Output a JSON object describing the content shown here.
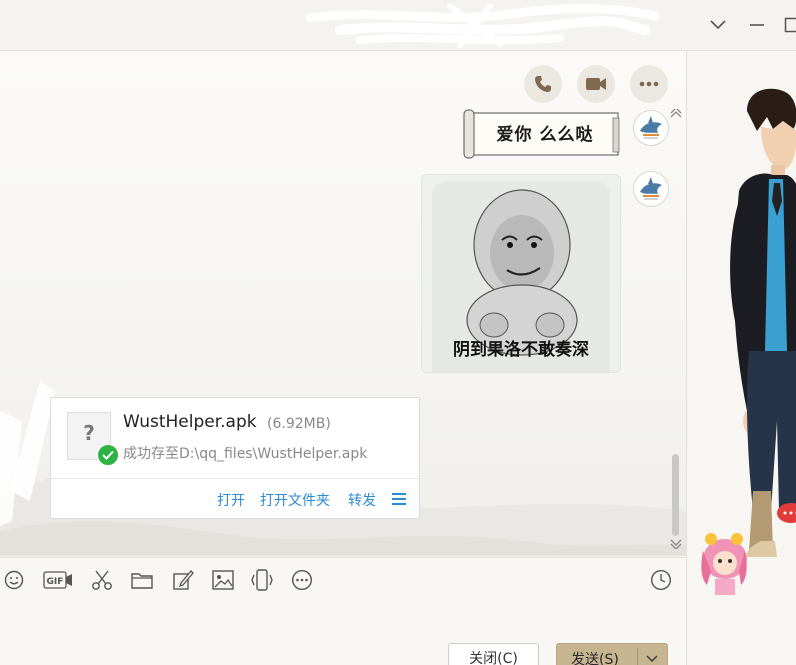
{
  "titlebar": {
    "minimize_icon": "minimize-icon",
    "collapse_icon": "chevron-down-icon",
    "maximize_icon": "maximize-icon"
  },
  "chat_header_actions": [
    {
      "name": "call-button",
      "icon": "phone-icon"
    },
    {
      "name": "video-button",
      "icon": "video-icon"
    },
    {
      "name": "more-button",
      "icon": "more-icon"
    }
  ],
  "messages": {
    "sticker_text": "爱你 么么哒",
    "meme_caption": "阴到果洛不敢奏深"
  },
  "file_transfer": {
    "file_name": "WustHelper.apk",
    "file_size": "(6.92MB)",
    "status": "成功存至D:\\qq_files\\WustHelper.apk",
    "actions": {
      "open": "打开",
      "open_folder": "打开文件夹",
      "forward": "转发"
    }
  },
  "toolbar_icons": [
    "emoji-icon",
    "gif-icon",
    "scissors-icon",
    "folder-icon",
    "screenshot-edit-icon",
    "image-icon",
    "shake-icon",
    "more-circle-icon",
    "history-clock-icon"
  ],
  "toolbar": {
    "gif_label": "GIF"
  },
  "buttons": {
    "close": "关闭(C)",
    "send": "发送(S)"
  },
  "colors": {
    "accent": "#c7b490",
    "link": "#2a8bd6",
    "success": "#2fb344"
  }
}
